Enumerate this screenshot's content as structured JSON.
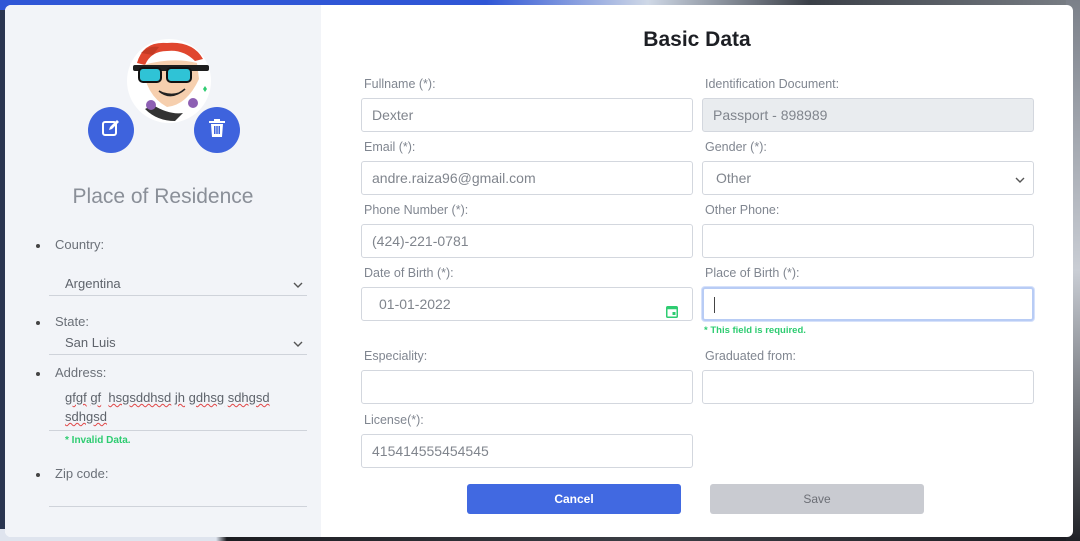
{
  "left_panel": {
    "section_title": "Place of Residence",
    "country": {
      "label": "Country:",
      "value": "Argentina"
    },
    "state": {
      "label": "State:",
      "value": "San Luis"
    },
    "address": {
      "label": "Address:",
      "value_line1_parts": [
        "gfgf",
        "gf",
        "hsgsddhsd",
        "jh",
        "gdhsg",
        "sdhgsd"
      ],
      "value_line2": "sdhgsd",
      "error": "* Invalid Data."
    },
    "zip": {
      "label": "Zip code:",
      "value": ""
    }
  },
  "form": {
    "title": "Basic Data",
    "fullname": {
      "label": "Fullname (*):",
      "value": "Dexter"
    },
    "identification": {
      "label": "Identification Document:",
      "value": "Passport - 898989"
    },
    "email": {
      "label": "Email (*):",
      "value": "andre.raiza96@gmail.com"
    },
    "gender": {
      "label": "Gender (*):",
      "value": "Other"
    },
    "phone": {
      "label": "Phone Number (*):",
      "value": "(424)-221-0781"
    },
    "other_phone": {
      "label": "Other Phone:",
      "value": ""
    },
    "dob": {
      "label": "Date of Birth (*):",
      "value": "01-01-2022"
    },
    "place_of_birth": {
      "label": "Place of Birth (*):",
      "value": "",
      "error": "* This field is required."
    },
    "especiality": {
      "label": "Especiality:",
      "value": ""
    },
    "graduated": {
      "label": "Graduated from:",
      "value": ""
    },
    "license": {
      "label": "License(*):",
      "value": "415414555454545"
    }
  },
  "buttons": {
    "cancel": "Cancel",
    "save": "Save"
  },
  "colors": {
    "primary": "#4169e1",
    "success": "#2ecc71",
    "panel": "#f2f4f8"
  },
  "icons": {
    "edit": "edit-icon",
    "delete": "trash-icon",
    "calendar": "calendar-icon",
    "chevron": "chevron-down-icon"
  }
}
